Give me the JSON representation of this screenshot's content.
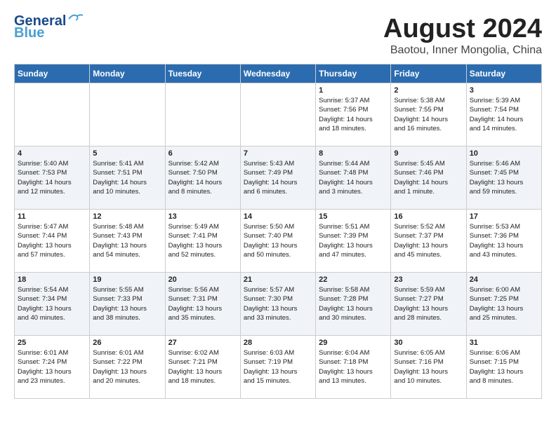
{
  "header": {
    "logo_line1": "General",
    "logo_line2": "Blue",
    "month": "August 2024",
    "location": "Baotou, Inner Mongolia, China"
  },
  "days_of_week": [
    "Sunday",
    "Monday",
    "Tuesday",
    "Wednesday",
    "Thursday",
    "Friday",
    "Saturday"
  ],
  "weeks": [
    [
      {
        "day": "",
        "info": ""
      },
      {
        "day": "",
        "info": ""
      },
      {
        "day": "",
        "info": ""
      },
      {
        "day": "",
        "info": ""
      },
      {
        "day": "1",
        "info": "Sunrise: 5:37 AM\nSunset: 7:56 PM\nDaylight: 14 hours\nand 18 minutes."
      },
      {
        "day": "2",
        "info": "Sunrise: 5:38 AM\nSunset: 7:55 PM\nDaylight: 14 hours\nand 16 minutes."
      },
      {
        "day": "3",
        "info": "Sunrise: 5:39 AM\nSunset: 7:54 PM\nDaylight: 14 hours\nand 14 minutes."
      }
    ],
    [
      {
        "day": "4",
        "info": "Sunrise: 5:40 AM\nSunset: 7:53 PM\nDaylight: 14 hours\nand 12 minutes."
      },
      {
        "day": "5",
        "info": "Sunrise: 5:41 AM\nSunset: 7:51 PM\nDaylight: 14 hours\nand 10 minutes."
      },
      {
        "day": "6",
        "info": "Sunrise: 5:42 AM\nSunset: 7:50 PM\nDaylight: 14 hours\nand 8 minutes."
      },
      {
        "day": "7",
        "info": "Sunrise: 5:43 AM\nSunset: 7:49 PM\nDaylight: 14 hours\nand 6 minutes."
      },
      {
        "day": "8",
        "info": "Sunrise: 5:44 AM\nSunset: 7:48 PM\nDaylight: 14 hours\nand 3 minutes."
      },
      {
        "day": "9",
        "info": "Sunrise: 5:45 AM\nSunset: 7:46 PM\nDaylight: 14 hours\nand 1 minute."
      },
      {
        "day": "10",
        "info": "Sunrise: 5:46 AM\nSunset: 7:45 PM\nDaylight: 13 hours\nand 59 minutes."
      }
    ],
    [
      {
        "day": "11",
        "info": "Sunrise: 5:47 AM\nSunset: 7:44 PM\nDaylight: 13 hours\nand 57 minutes."
      },
      {
        "day": "12",
        "info": "Sunrise: 5:48 AM\nSunset: 7:43 PM\nDaylight: 13 hours\nand 54 minutes."
      },
      {
        "day": "13",
        "info": "Sunrise: 5:49 AM\nSunset: 7:41 PM\nDaylight: 13 hours\nand 52 minutes."
      },
      {
        "day": "14",
        "info": "Sunrise: 5:50 AM\nSunset: 7:40 PM\nDaylight: 13 hours\nand 50 minutes."
      },
      {
        "day": "15",
        "info": "Sunrise: 5:51 AM\nSunset: 7:39 PM\nDaylight: 13 hours\nand 47 minutes."
      },
      {
        "day": "16",
        "info": "Sunrise: 5:52 AM\nSunset: 7:37 PM\nDaylight: 13 hours\nand 45 minutes."
      },
      {
        "day": "17",
        "info": "Sunrise: 5:53 AM\nSunset: 7:36 PM\nDaylight: 13 hours\nand 43 minutes."
      }
    ],
    [
      {
        "day": "18",
        "info": "Sunrise: 5:54 AM\nSunset: 7:34 PM\nDaylight: 13 hours\nand 40 minutes."
      },
      {
        "day": "19",
        "info": "Sunrise: 5:55 AM\nSunset: 7:33 PM\nDaylight: 13 hours\nand 38 minutes."
      },
      {
        "day": "20",
        "info": "Sunrise: 5:56 AM\nSunset: 7:31 PM\nDaylight: 13 hours\nand 35 minutes."
      },
      {
        "day": "21",
        "info": "Sunrise: 5:57 AM\nSunset: 7:30 PM\nDaylight: 13 hours\nand 33 minutes."
      },
      {
        "day": "22",
        "info": "Sunrise: 5:58 AM\nSunset: 7:28 PM\nDaylight: 13 hours\nand 30 minutes."
      },
      {
        "day": "23",
        "info": "Sunrise: 5:59 AM\nSunset: 7:27 PM\nDaylight: 13 hours\nand 28 minutes."
      },
      {
        "day": "24",
        "info": "Sunrise: 6:00 AM\nSunset: 7:25 PM\nDaylight: 13 hours\nand 25 minutes."
      }
    ],
    [
      {
        "day": "25",
        "info": "Sunrise: 6:01 AM\nSunset: 7:24 PM\nDaylight: 13 hours\nand 23 minutes."
      },
      {
        "day": "26",
        "info": "Sunrise: 6:01 AM\nSunset: 7:22 PM\nDaylight: 13 hours\nand 20 minutes."
      },
      {
        "day": "27",
        "info": "Sunrise: 6:02 AM\nSunset: 7:21 PM\nDaylight: 13 hours\nand 18 minutes."
      },
      {
        "day": "28",
        "info": "Sunrise: 6:03 AM\nSunset: 7:19 PM\nDaylight: 13 hours\nand 15 minutes."
      },
      {
        "day": "29",
        "info": "Sunrise: 6:04 AM\nSunset: 7:18 PM\nDaylight: 13 hours\nand 13 minutes."
      },
      {
        "day": "30",
        "info": "Sunrise: 6:05 AM\nSunset: 7:16 PM\nDaylight: 13 hours\nand 10 minutes."
      },
      {
        "day": "31",
        "info": "Sunrise: 6:06 AM\nSunset: 7:15 PM\nDaylight: 13 hours\nand 8 minutes."
      }
    ]
  ]
}
